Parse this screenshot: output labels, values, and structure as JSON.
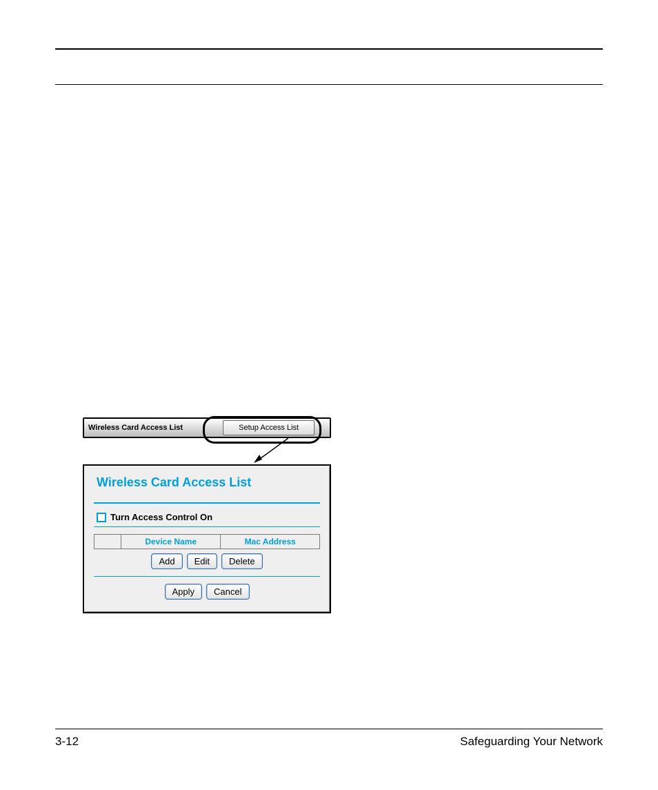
{
  "figure": {
    "bar_label": "Wireless Card Access List",
    "bar_button": "Setup Access List",
    "panel_title": "Wireless Card Access List",
    "checkbox_label": "Turn Access Control On",
    "columns": {
      "col1": "Device Name",
      "col2": "Mac Address"
    },
    "buttons": {
      "add": "Add",
      "edit": "Edit",
      "delete": "Delete",
      "apply": "Apply",
      "cancel": "Cancel"
    }
  },
  "footer": {
    "page": "3-12",
    "section": "Safeguarding Your Network"
  }
}
